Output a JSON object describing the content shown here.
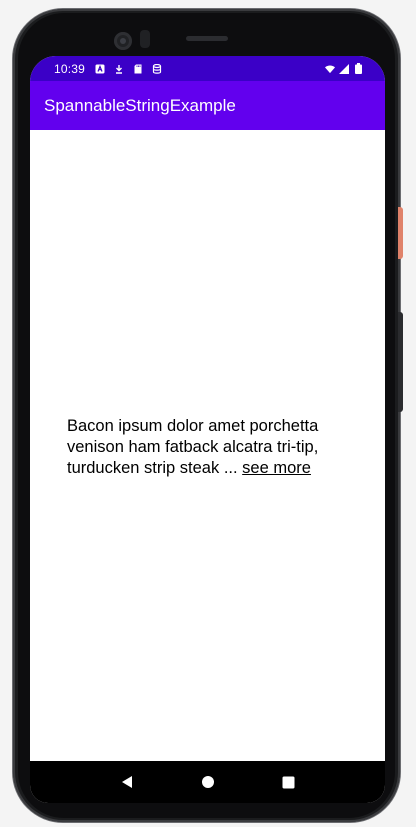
{
  "status_bar": {
    "time": "10:39",
    "left_icons": [
      "a-notification-icon",
      "download-icon",
      "sd-card-icon",
      "database-icon"
    ],
    "right_icons": [
      "wifi-icon",
      "signal-icon",
      "battery-icon"
    ]
  },
  "app_bar": {
    "title": "SpannableStringExample"
  },
  "content": {
    "text": "Bacon ipsum dolor amet porchetta venison ham fatback alcatra tri-tip, turducken strip steak ... ",
    "link_label": "see more"
  },
  "nav_bar": {
    "buttons": [
      "back-icon",
      "home-icon",
      "recents-icon"
    ]
  },
  "colors": {
    "status_bar": "#3b00c7",
    "app_bar": "#6200ee",
    "text": "#000000"
  }
}
